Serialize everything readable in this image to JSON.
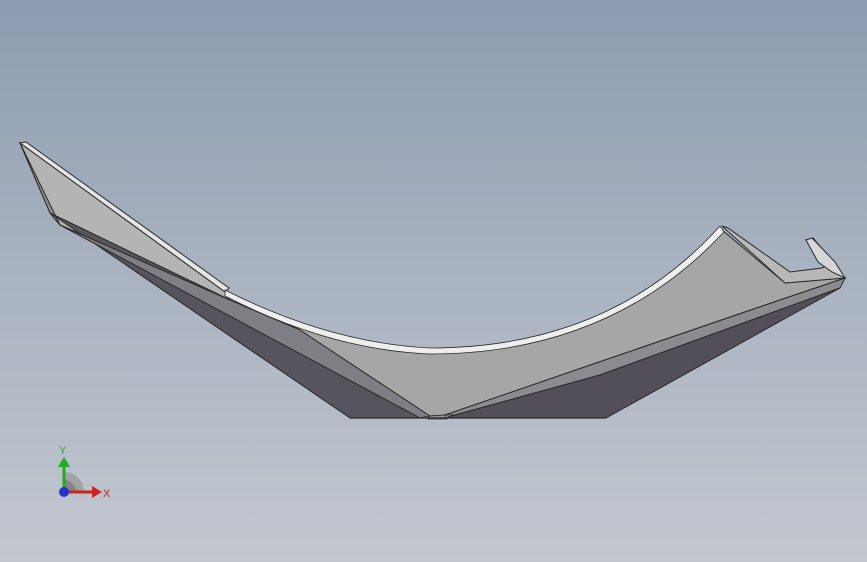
{
  "viewport": {
    "background_top": "#8b9cb0",
    "background_bottom": "#c3c7d0",
    "model": {
      "name": "sheet-metal-bracket",
      "face_color_top": "#a8a8a8",
      "face_color_dark": "#5a5860",
      "edge_color": "#2a2a2a"
    },
    "triad": {
      "x_label": "X",
      "y_label": "Y",
      "x_color": "#cc2222",
      "y_color": "#22aa22",
      "z_color": "#2233cc"
    }
  }
}
